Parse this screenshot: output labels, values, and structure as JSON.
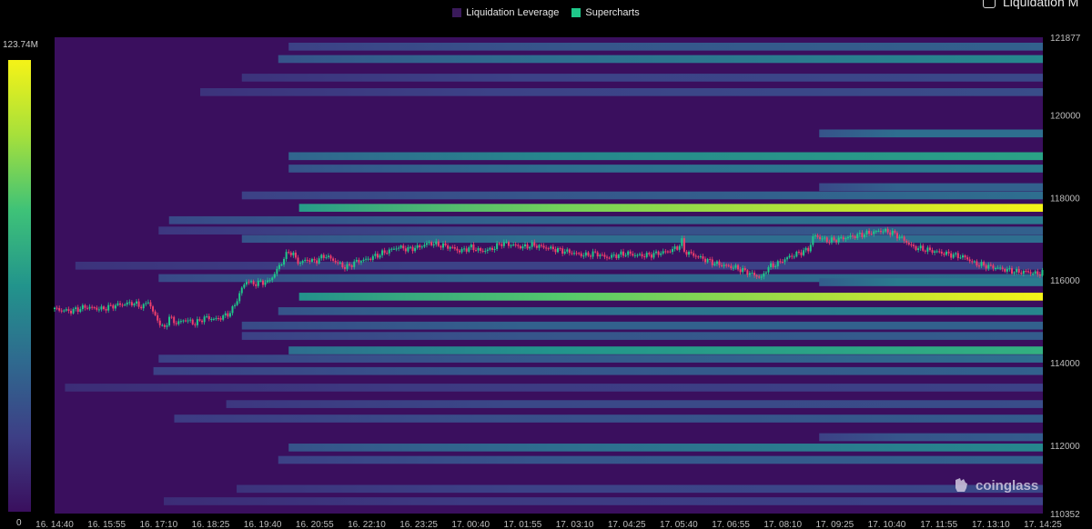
{
  "legend": {
    "items": [
      {
        "label": "Liquidation Leverage",
        "color": "#3a1a5a"
      },
      {
        "label": "Supercharts",
        "color": "#1fc88a"
      }
    ]
  },
  "corner_toggle": {
    "label": "Liquidation M"
  },
  "watermark": {
    "label": "coinglass"
  },
  "colorscale": {
    "max_label": "123.74M",
    "min_label": "0",
    "stops": [
      "#3a0f5e",
      "#3d3f86",
      "#2f6a8f",
      "#22948c",
      "#3ec278",
      "#a6e03b",
      "#f5f317"
    ]
  },
  "chart_data": {
    "type": "heatmap",
    "title": "",
    "xlabel": "",
    "ylabel": "",
    "ylim": [
      110352,
      121877
    ],
    "y_ticks": [
      {
        "value": 121877,
        "label": "121877"
      },
      {
        "value": 120000,
        "label": "120000"
      },
      {
        "value": 118000,
        "label": "118000"
      },
      {
        "value": 116000,
        "label": "116000"
      },
      {
        "value": 114000,
        "label": "114000"
      },
      {
        "value": 112000,
        "label": "112000"
      },
      {
        "value": 110352,
        "label": "110352"
      }
    ],
    "x_labels": [
      "16. 14:40",
      "16. 15:55",
      "16. 17:10",
      "16. 18:25",
      "16. 19:40",
      "16. 20:55",
      "16. 22:10",
      "16. 23:25",
      "17. 00:40",
      "17. 01:55",
      "17. 03:10",
      "17. 04:25",
      "17. 05:40",
      "17. 06:55",
      "17. 08:10",
      "17. 09:25",
      "17. 10:40",
      "17. 11:55",
      "17. 13:10",
      "17. 14:25"
    ],
    "x_range": [
      0,
      19
    ],
    "liquidation_bands": [
      {
        "price": 121650,
        "start": 4.5,
        "end_intensity": 0.3,
        "peak_intensity": 0.25
      },
      {
        "price": 121350,
        "start": 4.3,
        "end_intensity": 0.45,
        "peak_intensity": 0.35
      },
      {
        "price": 120900,
        "start": 3.6,
        "end_intensity": 0.2,
        "peak_intensity": 0.18
      },
      {
        "price": 120550,
        "start": 2.8,
        "end_intensity": 0.22,
        "peak_intensity": 0.18
      },
      {
        "price": 119550,
        "start": 14.7,
        "end_intensity": 0.35,
        "peak_intensity": 0.35
      },
      {
        "price": 119000,
        "start": 4.5,
        "end_intensity": 0.55,
        "peak_intensity": 0.45
      },
      {
        "price": 118700,
        "start": 4.5,
        "end_intensity": 0.4,
        "peak_intensity": 0.35
      },
      {
        "price": 118250,
        "start": 14.7,
        "end_intensity": 0.3,
        "peak_intensity": 0.3
      },
      {
        "price": 118050,
        "start": 3.6,
        "end_intensity": 0.35,
        "peak_intensity": 0.25
      },
      {
        "price": 117750,
        "start": 4.7,
        "end_intensity": 1.0,
        "peak_intensity": 0.75
      },
      {
        "price": 117450,
        "start": 2.2,
        "end_intensity": 0.4,
        "peak_intensity": 0.3
      },
      {
        "price": 117200,
        "start": 2.0,
        "end_intensity": 0.3,
        "peak_intensity": 0.2
      },
      {
        "price": 117000,
        "start": 3.6,
        "end_intensity": 0.35,
        "peak_intensity": 0.35
      },
      {
        "price": 116350,
        "start": 0.4,
        "end_intensity": 0.18,
        "peak_intensity": 0.18
      },
      {
        "price": 116050,
        "start": 2.0,
        "end_intensity": 0.35,
        "peak_intensity": 0.3
      },
      {
        "price": 115950,
        "start": 14.7,
        "end_intensity": 0.4,
        "peak_intensity": 0.4
      },
      {
        "price": 115600,
        "start": 4.7,
        "end_intensity": 1.0,
        "peak_intensity": 0.7
      },
      {
        "price": 115250,
        "start": 4.3,
        "end_intensity": 0.45,
        "peak_intensity": 0.35
      },
      {
        "price": 114900,
        "start": 3.6,
        "end_intensity": 0.3,
        "peak_intensity": 0.3
      },
      {
        "price": 114650,
        "start": 3.6,
        "end_intensity": 0.28,
        "peak_intensity": 0.25
      },
      {
        "price": 114300,
        "start": 4.5,
        "end_intensity": 0.6,
        "peak_intensity": 0.5
      },
      {
        "price": 114100,
        "start": 2.0,
        "end_intensity": 0.35,
        "peak_intensity": 0.25
      },
      {
        "price": 113800,
        "start": 1.9,
        "end_intensity": 0.3,
        "peak_intensity": 0.25
      },
      {
        "price": 113400,
        "start": 0.2,
        "end_intensity": 0.18,
        "peak_intensity": 0.15
      },
      {
        "price": 113000,
        "start": 3.3,
        "end_intensity": 0.22,
        "peak_intensity": 0.2
      },
      {
        "price": 112650,
        "start": 2.3,
        "end_intensity": 0.28,
        "peak_intensity": 0.22
      },
      {
        "price": 112200,
        "start": 14.7,
        "end_intensity": 0.28,
        "peak_intensity": 0.25
      },
      {
        "price": 111950,
        "start": 4.5,
        "end_intensity": 0.45,
        "peak_intensity": 0.35
      },
      {
        "price": 111650,
        "start": 4.3,
        "end_intensity": 0.3,
        "peak_intensity": 0.25
      },
      {
        "price": 110950,
        "start": 3.5,
        "end_intensity": 0.2,
        "peak_intensity": 0.18
      },
      {
        "price": 110650,
        "start": 2.1,
        "end_intensity": 0.18,
        "peak_intensity": 0.15
      }
    ],
    "price_path": [
      [
        0.0,
        115300
      ],
      [
        0.3,
        115250
      ],
      [
        0.6,
        115350
      ],
      [
        0.9,
        115300
      ],
      [
        1.2,
        115400
      ],
      [
        1.5,
        115450
      ],
      [
        1.7,
        115350
      ],
      [
        1.8,
        115500
      ],
      [
        1.9,
        115200
      ],
      [
        2.0,
        115000
      ],
      [
        2.1,
        114800
      ],
      [
        2.2,
        115100
      ],
      [
        2.35,
        114950
      ],
      [
        2.5,
        115050
      ],
      [
        2.7,
        114950
      ],
      [
        2.9,
        115100
      ],
      [
        3.1,
        115050
      ],
      [
        3.3,
        115150
      ],
      [
        3.4,
        115250
      ],
      [
        3.5,
        115500
      ],
      [
        3.6,
        115800
      ],
      [
        3.7,
        116000
      ],
      [
        3.8,
        115900
      ],
      [
        3.95,
        115950
      ],
      [
        4.1,
        115950
      ],
      [
        4.2,
        116100
      ],
      [
        4.3,
        116300
      ],
      [
        4.4,
        116500
      ],
      [
        4.5,
        116700
      ],
      [
        4.6,
        116600
      ],
      [
        4.7,
        116400
      ],
      [
        4.85,
        116500
      ],
      [
        5.0,
        116450
      ],
      [
        5.2,
        116600
      ],
      [
        5.4,
        116450
      ],
      [
        5.6,
        116300
      ],
      [
        5.8,
        116450
      ],
      [
        6.0,
        116500
      ],
      [
        6.2,
        116600
      ],
      [
        6.4,
        116700
      ],
      [
        6.6,
        116800
      ],
      [
        6.8,
        116750
      ],
      [
        7.0,
        116800
      ],
      [
        7.2,
        116900
      ],
      [
        7.4,
        116850
      ],
      [
        7.6,
        116800
      ],
      [
        7.8,
        116700
      ],
      [
        8.0,
        116800
      ],
      [
        8.2,
        116700
      ],
      [
        8.4,
        116750
      ],
      [
        8.6,
        116900
      ],
      [
        8.8,
        116850
      ],
      [
        9.0,
        116800
      ],
      [
        9.2,
        116850
      ],
      [
        9.4,
        116800
      ],
      [
        9.6,
        116750
      ],
      [
        9.8,
        116700
      ],
      [
        10.0,
        116650
      ],
      [
        10.2,
        116600
      ],
      [
        10.4,
        116650
      ],
      [
        10.6,
        116550
      ],
      [
        10.8,
        116600
      ],
      [
        11.0,
        116650
      ],
      [
        11.2,
        116600
      ],
      [
        11.4,
        116600
      ],
      [
        11.6,
        116650
      ],
      [
        11.8,
        116700
      ],
      [
        12.0,
        116800
      ],
      [
        12.05,
        117000
      ],
      [
        12.1,
        116700
      ],
      [
        12.3,
        116600
      ],
      [
        12.5,
        116500
      ],
      [
        12.7,
        116400
      ],
      [
        12.9,
        116350
      ],
      [
        13.1,
        116300
      ],
      [
        13.3,
        116200
      ],
      [
        13.5,
        116100
      ],
      [
        13.6,
        116050
      ],
      [
        13.7,
        116300
      ],
      [
        13.9,
        116400
      ],
      [
        14.1,
        116550
      ],
      [
        14.3,
        116650
      ],
      [
        14.5,
        116750
      ],
      [
        14.6,
        117100
      ],
      [
        14.75,
        117000
      ],
      [
        14.9,
        116950
      ],
      [
        15.1,
        117000
      ],
      [
        15.3,
        117050
      ],
      [
        15.5,
        117100
      ],
      [
        15.7,
        117150
      ],
      [
        15.9,
        117200
      ],
      [
        16.1,
        117150
      ],
      [
        16.3,
        117000
      ],
      [
        16.5,
        116800
      ],
      [
        16.7,
        116750
      ],
      [
        16.9,
        116700
      ],
      [
        17.1,
        116650
      ],
      [
        17.3,
        116600
      ],
      [
        17.5,
        116550
      ],
      [
        17.7,
        116400
      ],
      [
        17.9,
        116350
      ],
      [
        18.1,
        116300
      ],
      [
        18.3,
        116250
      ],
      [
        18.5,
        116200
      ],
      [
        18.7,
        116200
      ],
      [
        18.9,
        116150
      ],
      [
        19.0,
        116200
      ]
    ]
  }
}
